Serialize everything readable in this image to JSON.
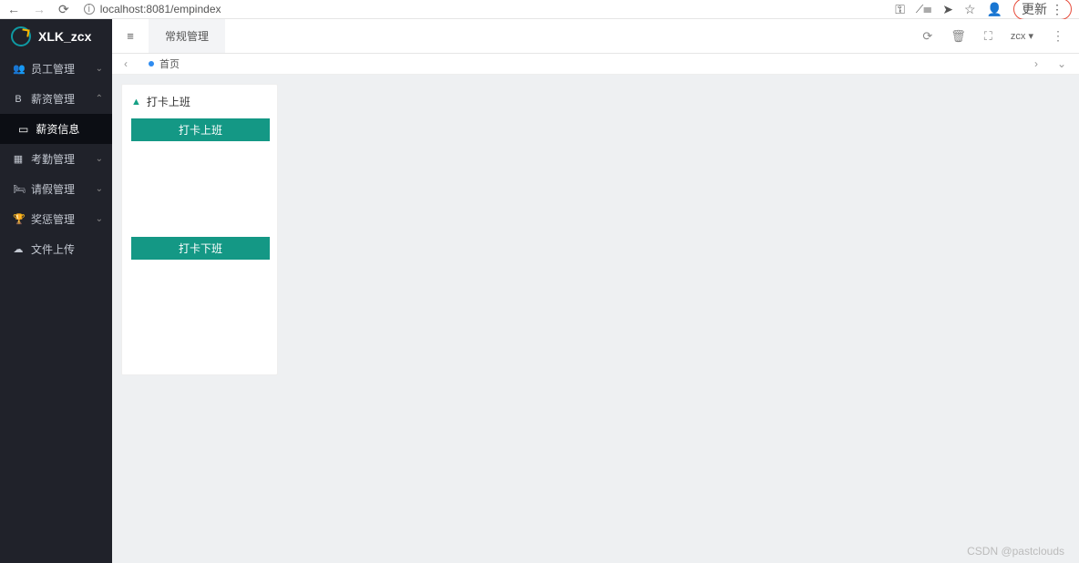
{
  "browser": {
    "url": "localhost:8081/empindex",
    "update_label": "更新"
  },
  "brand": {
    "name": "XLK_zcx"
  },
  "sidebar": {
    "items": [
      {
        "icon": "users-icon",
        "label": "员工管理",
        "expandable": true,
        "open": false
      },
      {
        "icon": "bitcoin-icon",
        "label": "薪资管理",
        "expandable": true,
        "open": true,
        "children": [
          {
            "icon": "card-icon",
            "label": "薪资信息",
            "active": true
          }
        ]
      },
      {
        "icon": "calendar-icon",
        "label": "考勤管理",
        "expandable": true,
        "open": false
      },
      {
        "icon": "bed-icon",
        "label": "请假管理",
        "expandable": true,
        "open": false
      },
      {
        "icon": "trophy-icon",
        "label": "奖惩管理",
        "expandable": true,
        "open": false
      },
      {
        "icon": "cloud-icon",
        "label": "文件上传",
        "expandable": false
      }
    ]
  },
  "topbar": {
    "tab_label": "常规管理",
    "user_label": "zcx"
  },
  "tabsrow": {
    "tabs": [
      {
        "label": "首页",
        "active": true
      }
    ]
  },
  "card": {
    "title": "打卡上班",
    "btn_in": "打卡上班",
    "btn_out": "打卡下班"
  },
  "watermark": "CSDN @pastclouds"
}
